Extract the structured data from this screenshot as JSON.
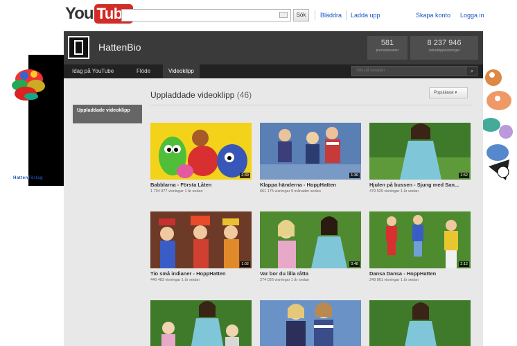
{
  "youtube": {
    "logo_you": "You",
    "logo_tube": "Tube",
    "search_button": "Sök",
    "links": [
      "Bläddra",
      "Ladda upp"
    ],
    "right_links": [
      "Skapa konto",
      "Logga in"
    ]
  },
  "side_brand": "HattenFörlag",
  "channel": {
    "name": "HattenBio",
    "stats": [
      {
        "value": "581",
        "label": "prenumeranter"
      },
      {
        "value": "8 237 946",
        "label": "videoklippsvisningar"
      }
    ],
    "nav": [
      "Idag på YouTube",
      "Flöde",
      "Videoklipp"
    ],
    "search_placeholder": "Sök på kanalen",
    "side_tab": "Uppladdade videoklipp",
    "section_title": "Uppladdade videoklipp",
    "section_count": "(46)",
    "sort_label": "Populärast ▾"
  },
  "videos": [
    {
      "title": "Babblarna - Första Låten",
      "meta": "1 794 977 visningar 1 år sedan",
      "duration": "2:39"
    },
    {
      "title": "Klappa händerna - HoppHatten",
      "meta": "661 175 visningar 9 månader sedan",
      "duration": "1:36"
    },
    {
      "title": "Hjulen på bussen - Sjung med San...",
      "meta": "479 529 visningar 1 år sedan",
      "duration": "1:52"
    },
    {
      "title": "Tio små indianer - HoppHatten",
      "meta": "446 483 visningar 1 år sedan",
      "duration": "1:02"
    },
    {
      "title": "Var bor du lilla råtta",
      "meta": "274 026 visningar 1 år sedan",
      "duration": "0:48"
    },
    {
      "title": "Dansa Dansa - HoppHatten",
      "meta": "248 861 visningar 1 år sedan",
      "duration": "2:12"
    },
    {
      "title": "",
      "meta": "",
      "duration": ""
    },
    {
      "title": "",
      "meta": "",
      "duration": ""
    },
    {
      "title": "",
      "meta": "",
      "duration": ""
    }
  ],
  "colors": {
    "accent_red": "#d12c26",
    "link_blue": "#1b55c2",
    "header_dark": "#3a3a3a"
  }
}
